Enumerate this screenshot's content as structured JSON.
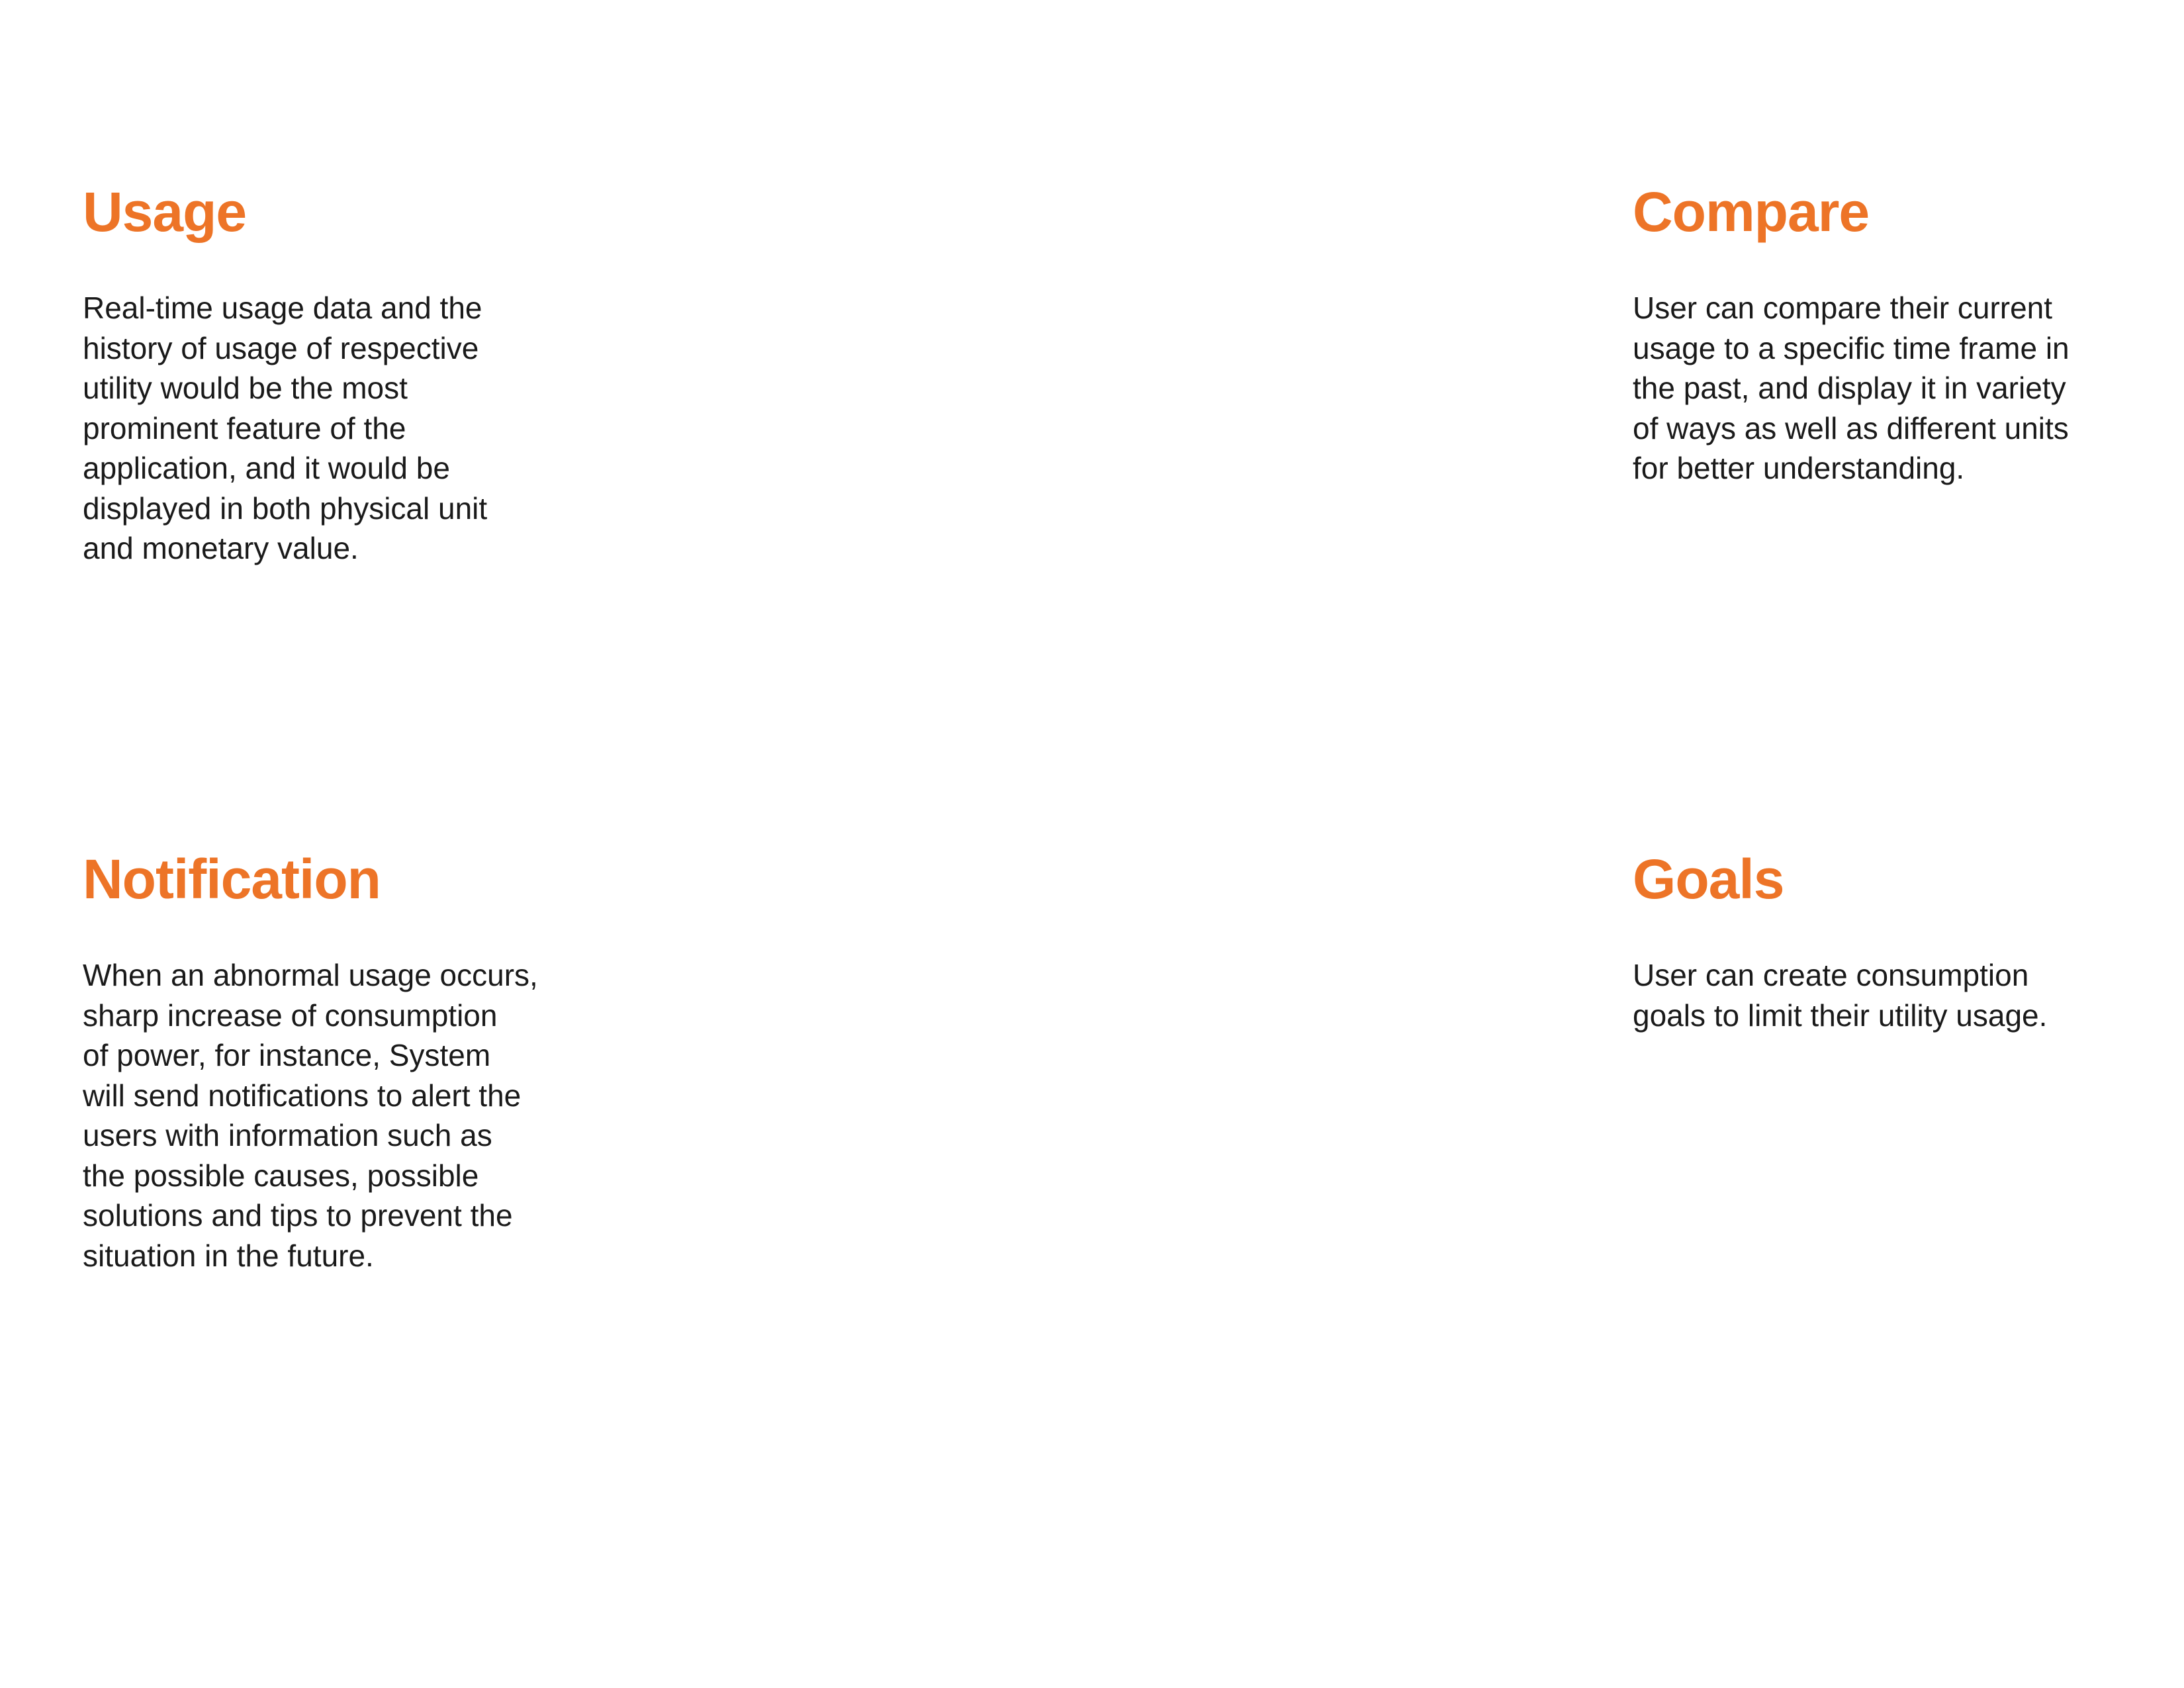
{
  "brand_color": "#ED7427",
  "sections": {
    "usage": {
      "title": "Usage",
      "lines": [
        "Real-time usage data and the",
        "history of usage of respective",
        "utility would be the most",
        "prominent feature of the",
        "application, and it would be",
        "displayed in both physical unit",
        "and monetary value."
      ]
    },
    "compare": {
      "title": "Compare",
      "lines": [
        "User can compare their current",
        "usage to a specific time frame in",
        "the past, and display it in variety",
        "of ways as well as different units",
        "for better understanding."
      ]
    },
    "notification": {
      "title": "Notification",
      "lines": [
        "When an abnormal usage occurs,",
        "sharp increase of consumption",
        "of power, for instance, System",
        "will send notifications to alert the",
        "users with information such as",
        "the possible causes, possible",
        "solutions and tips to prevent the",
        "situation in the future."
      ]
    },
    "goals": {
      "title": "Goals",
      "lines": [
        "User can create consumption",
        "goals to limit their utility usage."
      ]
    }
  }
}
